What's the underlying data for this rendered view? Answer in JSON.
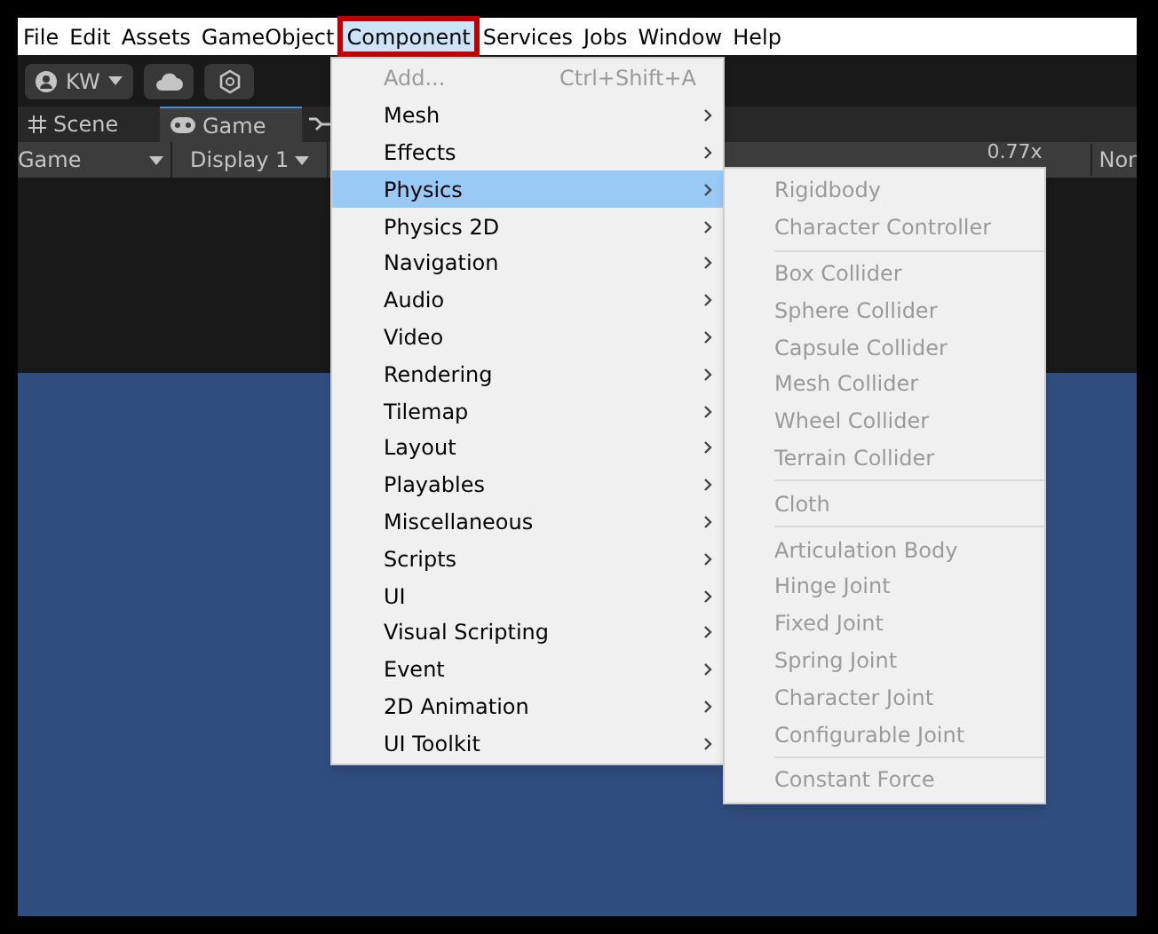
{
  "menu_bar": {
    "items": [
      {
        "label": "File",
        "selected": false
      },
      {
        "label": "Edit",
        "selected": false
      },
      {
        "label": "Assets",
        "selected": false
      },
      {
        "label": "GameObject",
        "selected": false
      },
      {
        "label": "Component",
        "selected": true
      },
      {
        "label": "Services",
        "selected": false
      },
      {
        "label": "Jobs",
        "selected": false
      },
      {
        "label": "Window",
        "selected": false
      },
      {
        "label": "Help",
        "selected": false
      }
    ]
  },
  "toolbar": {
    "account": "KW"
  },
  "tabs": [
    {
      "label": "Scene",
      "selected": false
    },
    {
      "label": "Game",
      "selected": true
    }
  ],
  "game_bar": {
    "view": "Game",
    "display": "Display 1",
    "scale": "0.77x",
    "aspect": "Nor"
  },
  "component_menu": {
    "items": [
      {
        "label": "Add...",
        "shortcut": "Ctrl+Shift+A",
        "disabled": true,
        "submenu": false,
        "selected": false
      },
      {
        "label": "Mesh",
        "disabled": false,
        "submenu": true,
        "selected": false
      },
      {
        "label": "Effects",
        "disabled": false,
        "submenu": true,
        "selected": false
      },
      {
        "label": "Physics",
        "disabled": false,
        "submenu": true,
        "selected": true
      },
      {
        "label": "Physics 2D",
        "disabled": false,
        "submenu": true,
        "selected": false
      },
      {
        "label": "Navigation",
        "disabled": false,
        "submenu": true,
        "selected": false
      },
      {
        "label": "Audio",
        "disabled": false,
        "submenu": true,
        "selected": false
      },
      {
        "label": "Video",
        "disabled": false,
        "submenu": true,
        "selected": false
      },
      {
        "label": "Rendering",
        "disabled": false,
        "submenu": true,
        "selected": false
      },
      {
        "label": "Tilemap",
        "disabled": false,
        "submenu": true,
        "selected": false
      },
      {
        "label": "Layout",
        "disabled": false,
        "submenu": true,
        "selected": false
      },
      {
        "label": "Playables",
        "disabled": false,
        "submenu": true,
        "selected": false
      },
      {
        "label": "Miscellaneous",
        "disabled": false,
        "submenu": true,
        "selected": false
      },
      {
        "label": "Scripts",
        "disabled": false,
        "submenu": true,
        "selected": false
      },
      {
        "label": "UI",
        "disabled": false,
        "submenu": true,
        "selected": false
      },
      {
        "label": "Visual Scripting",
        "disabled": false,
        "submenu": true,
        "selected": false
      },
      {
        "label": "Event",
        "disabled": false,
        "submenu": true,
        "selected": false
      },
      {
        "label": "2D Animation",
        "disabled": false,
        "submenu": true,
        "selected": false
      },
      {
        "label": "UI Toolkit",
        "disabled": false,
        "submenu": true,
        "selected": false
      }
    ]
  },
  "physics_submenu": {
    "groups": [
      [
        {
          "label": "Rigidbody",
          "disabled": true
        },
        {
          "label": "Character Controller",
          "disabled": true
        }
      ],
      [
        {
          "label": "Box Collider",
          "disabled": true
        },
        {
          "label": "Sphere Collider",
          "disabled": true
        },
        {
          "label": "Capsule Collider",
          "disabled": true
        },
        {
          "label": "Mesh Collider",
          "disabled": true
        },
        {
          "label": "Wheel Collider",
          "disabled": true
        },
        {
          "label": "Terrain Collider",
          "disabled": true
        }
      ],
      [
        {
          "label": "Cloth",
          "disabled": true
        }
      ],
      [
        {
          "label": "Articulation Body",
          "disabled": true
        },
        {
          "label": "Hinge Joint",
          "disabled": true
        },
        {
          "label": "Fixed Joint",
          "disabled": true
        },
        {
          "label": "Spring Joint",
          "disabled": true
        },
        {
          "label": "Character Joint",
          "disabled": true
        },
        {
          "label": "Configurable Joint",
          "disabled": true
        }
      ],
      [
        {
          "label": "Constant Force",
          "disabled": true
        }
      ]
    ]
  }
}
